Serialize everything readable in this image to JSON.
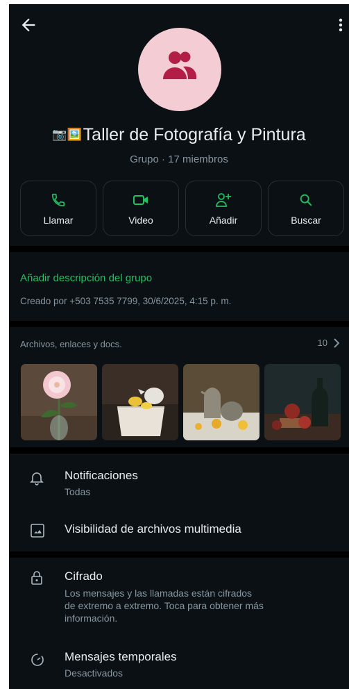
{
  "header": {
    "back_icon": "arrow-left-icon",
    "menu_icon": "more-vertical-icon"
  },
  "group": {
    "avatar_icon": "group-people-icon",
    "avatar_bg": "#f4ccd4",
    "avatar_icon_color": "#b21e46",
    "emoji": "📷🖼️",
    "name": "Taller de Fotografía y Pintura",
    "subtitle": "Grupo · 17 miembros"
  },
  "actions": [
    {
      "label": "Llamar",
      "icon": "phone-icon"
    },
    {
      "label": "Video",
      "icon": "video-icon"
    },
    {
      "label": "Añadir",
      "icon": "add-person-icon"
    },
    {
      "label": "Buscar",
      "icon": "search-icon"
    }
  ],
  "description": {
    "add_label": "Añadir descripción del grupo",
    "created": "Creado por +503 7535 7799, 30/6/2025, 4:15 p. m."
  },
  "media": {
    "title": "Archivos, enlaces y docs.",
    "count": "10",
    "thumbnails": [
      "flower-vase-photo",
      "lemon-teapot-still-life-photo",
      "lemon-jug-still-life-photo",
      "pomegranate-bottle-still-life-photo"
    ]
  },
  "settings": {
    "notifications": {
      "title": "Notificaciones",
      "subtitle": "Todas",
      "icon": "bell-icon"
    },
    "media_visibility": {
      "title": "Visibilidad de archivos multimedia",
      "icon": "image-icon"
    },
    "encryption": {
      "title": "Cifrado",
      "lines": [
        "Los mensajes y las llamadas están cifrados",
        "de extremo a extremo. Toca para obtener más",
        "información."
      ],
      "icon": "lock-icon"
    },
    "disappearing": {
      "title": "Mensajes temporales",
      "subtitle": "Desactivados",
      "icon": "timer-icon"
    }
  },
  "colors": {
    "accent": "#21c063",
    "background": "#0b1014",
    "text_secondary": "#8696a0"
  }
}
